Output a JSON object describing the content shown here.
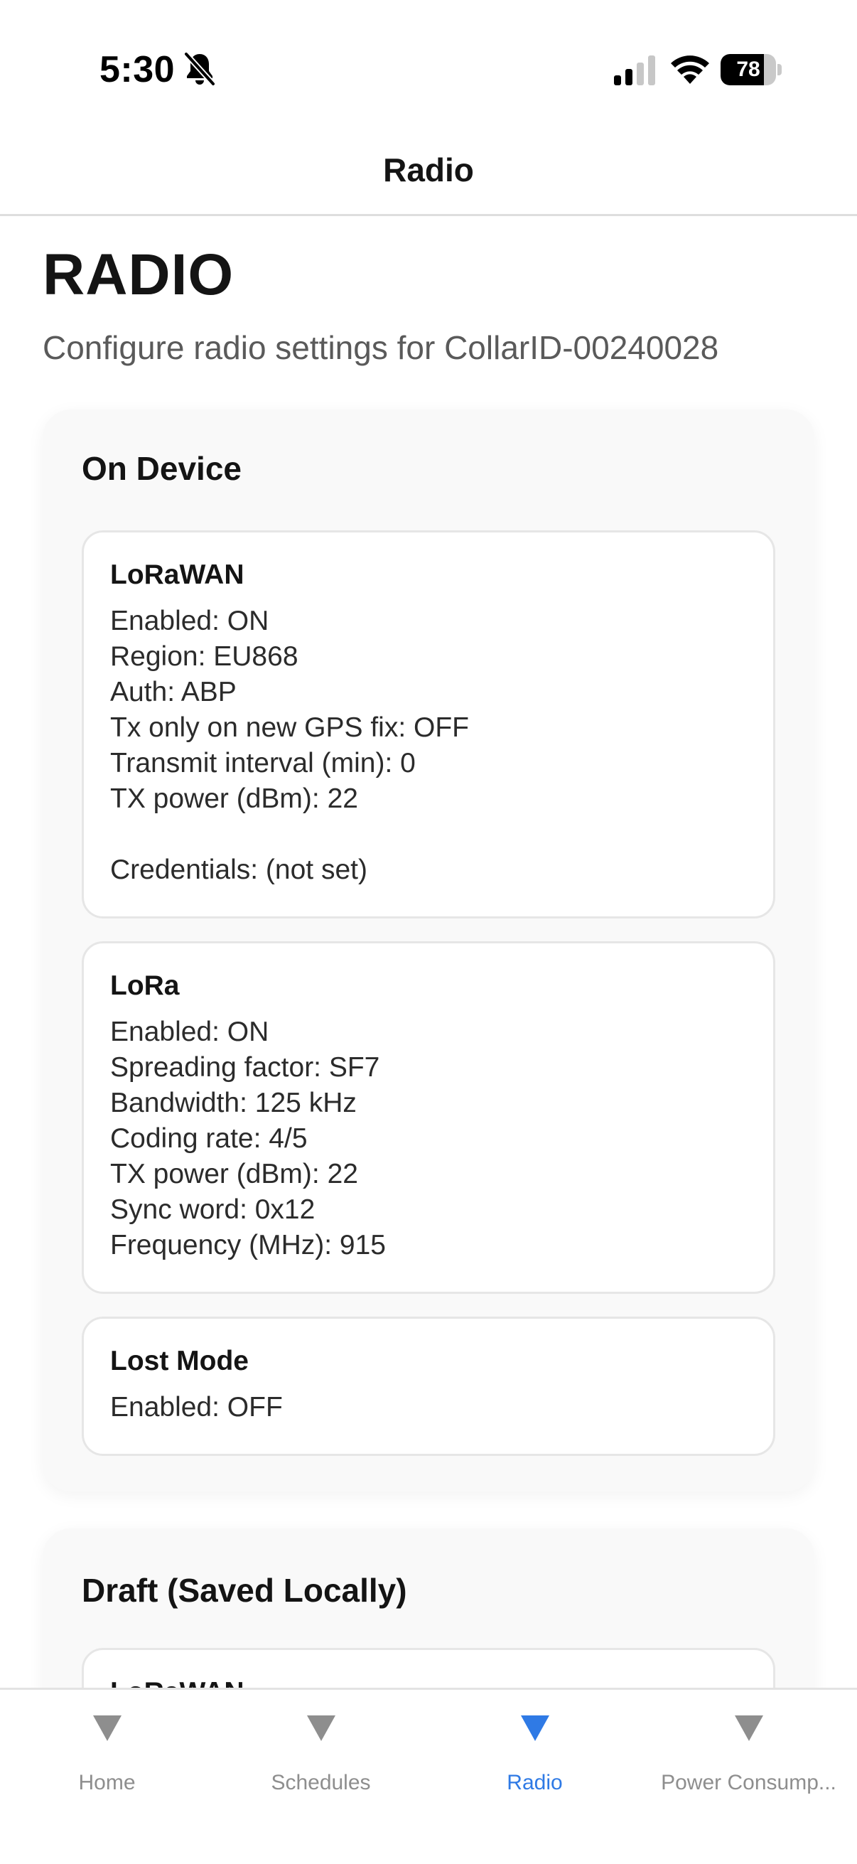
{
  "status_bar": {
    "time": "5:30",
    "battery": "78",
    "battery_level": 0.78,
    "silent_icon": "bell-slash-icon",
    "signal_icon": "cellular-signal-icon",
    "wifi_icon": "wifi-icon"
  },
  "header": {
    "title": "Radio"
  },
  "page": {
    "title": "RADIO",
    "subtitle": "Configure radio settings for CollarID-00240028"
  },
  "on_device": {
    "title": "On Device",
    "lorawan": {
      "title": "LoRaWAN",
      "lines": [
        "Enabled: ON",
        "Region: EU868",
        "Auth: ABP",
        "Tx only on new GPS fix: OFF",
        "Transmit interval (min): 0",
        "TX power (dBm): 22",
        "",
        "Credentials: (not set)"
      ]
    },
    "lora": {
      "title": "LoRa",
      "lines": [
        "Enabled: ON",
        "Spreading factor: SF7",
        "Bandwidth: 125 kHz",
        "Coding rate: 4/5",
        "TX power (dBm): 22",
        "Sync word: 0x12",
        "Frequency (MHz): 915"
      ]
    },
    "lost_mode": {
      "title": "Lost Mode",
      "lines": [
        "Enabled: OFF"
      ]
    }
  },
  "draft": {
    "title": "Draft (Saved Locally)",
    "lorawan": {
      "title": "LoRaWAN"
    }
  },
  "tabs": [
    {
      "label": "Home",
      "icon": "triangle-down-icon",
      "active": false
    },
    {
      "label": "Schedules",
      "icon": "triangle-down-icon",
      "active": false
    },
    {
      "label": "Radio",
      "icon": "triangle-down-icon",
      "active": true
    },
    {
      "label": "Power Consump...",
      "icon": "triangle-down-icon",
      "active": false
    }
  ],
  "colors": {
    "accent": "#2f7ae5",
    "tab_inactive": "#8e8e8e",
    "section_bg": "#f9f9f9",
    "card_border": "#e6e6e6"
  }
}
